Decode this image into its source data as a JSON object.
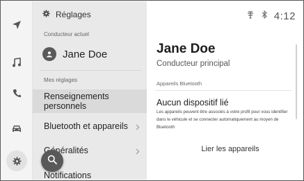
{
  "status_bar": {
    "time": "4:12",
    "icons": [
      "antenna-icon",
      "bluetooth-icon"
    ]
  },
  "rail": {
    "items": [
      {
        "icon": "navigation-arrow-icon",
        "active": false
      },
      {
        "icon": "music-note-icon",
        "active": false
      },
      {
        "icon": "phone-icon",
        "active": false
      },
      {
        "icon": "car-icon",
        "active": false
      },
      {
        "icon": "gear-icon",
        "active": true
      }
    ]
  },
  "list": {
    "header": "Réglages",
    "current_driver_label": "Conducteur actuel",
    "current_driver_name": "Jane Doe",
    "my_settings_label": "Mes réglages",
    "items": [
      {
        "label": "Renseignements personnels",
        "selected": true,
        "chevron": false
      },
      {
        "label": "Bluetooth et appareils",
        "selected": false,
        "chevron": true
      },
      {
        "label": "Généralités",
        "selected": false,
        "chevron": true
      },
      {
        "label": "Notifications",
        "selected": false,
        "chevron": false
      }
    ]
  },
  "detail": {
    "name": "Jane Doe",
    "role": "Conducteur principal",
    "section_label": "Appareils Bluetooth",
    "device_title": "Aucun dispositif lié",
    "device_description": "Les appareils peuvent être associés à votre profil pour vous identifier dans le véhicule et se connecter automatiquement au moyen de Bluetooth",
    "link_label": "Lier les appareils"
  },
  "colors": {
    "rail_bg": "#f4f4f4",
    "list_bg": "#e9e9e9",
    "selected_row": "#dadada",
    "detail_bg": "#ffffff",
    "fab": "#595959"
  }
}
